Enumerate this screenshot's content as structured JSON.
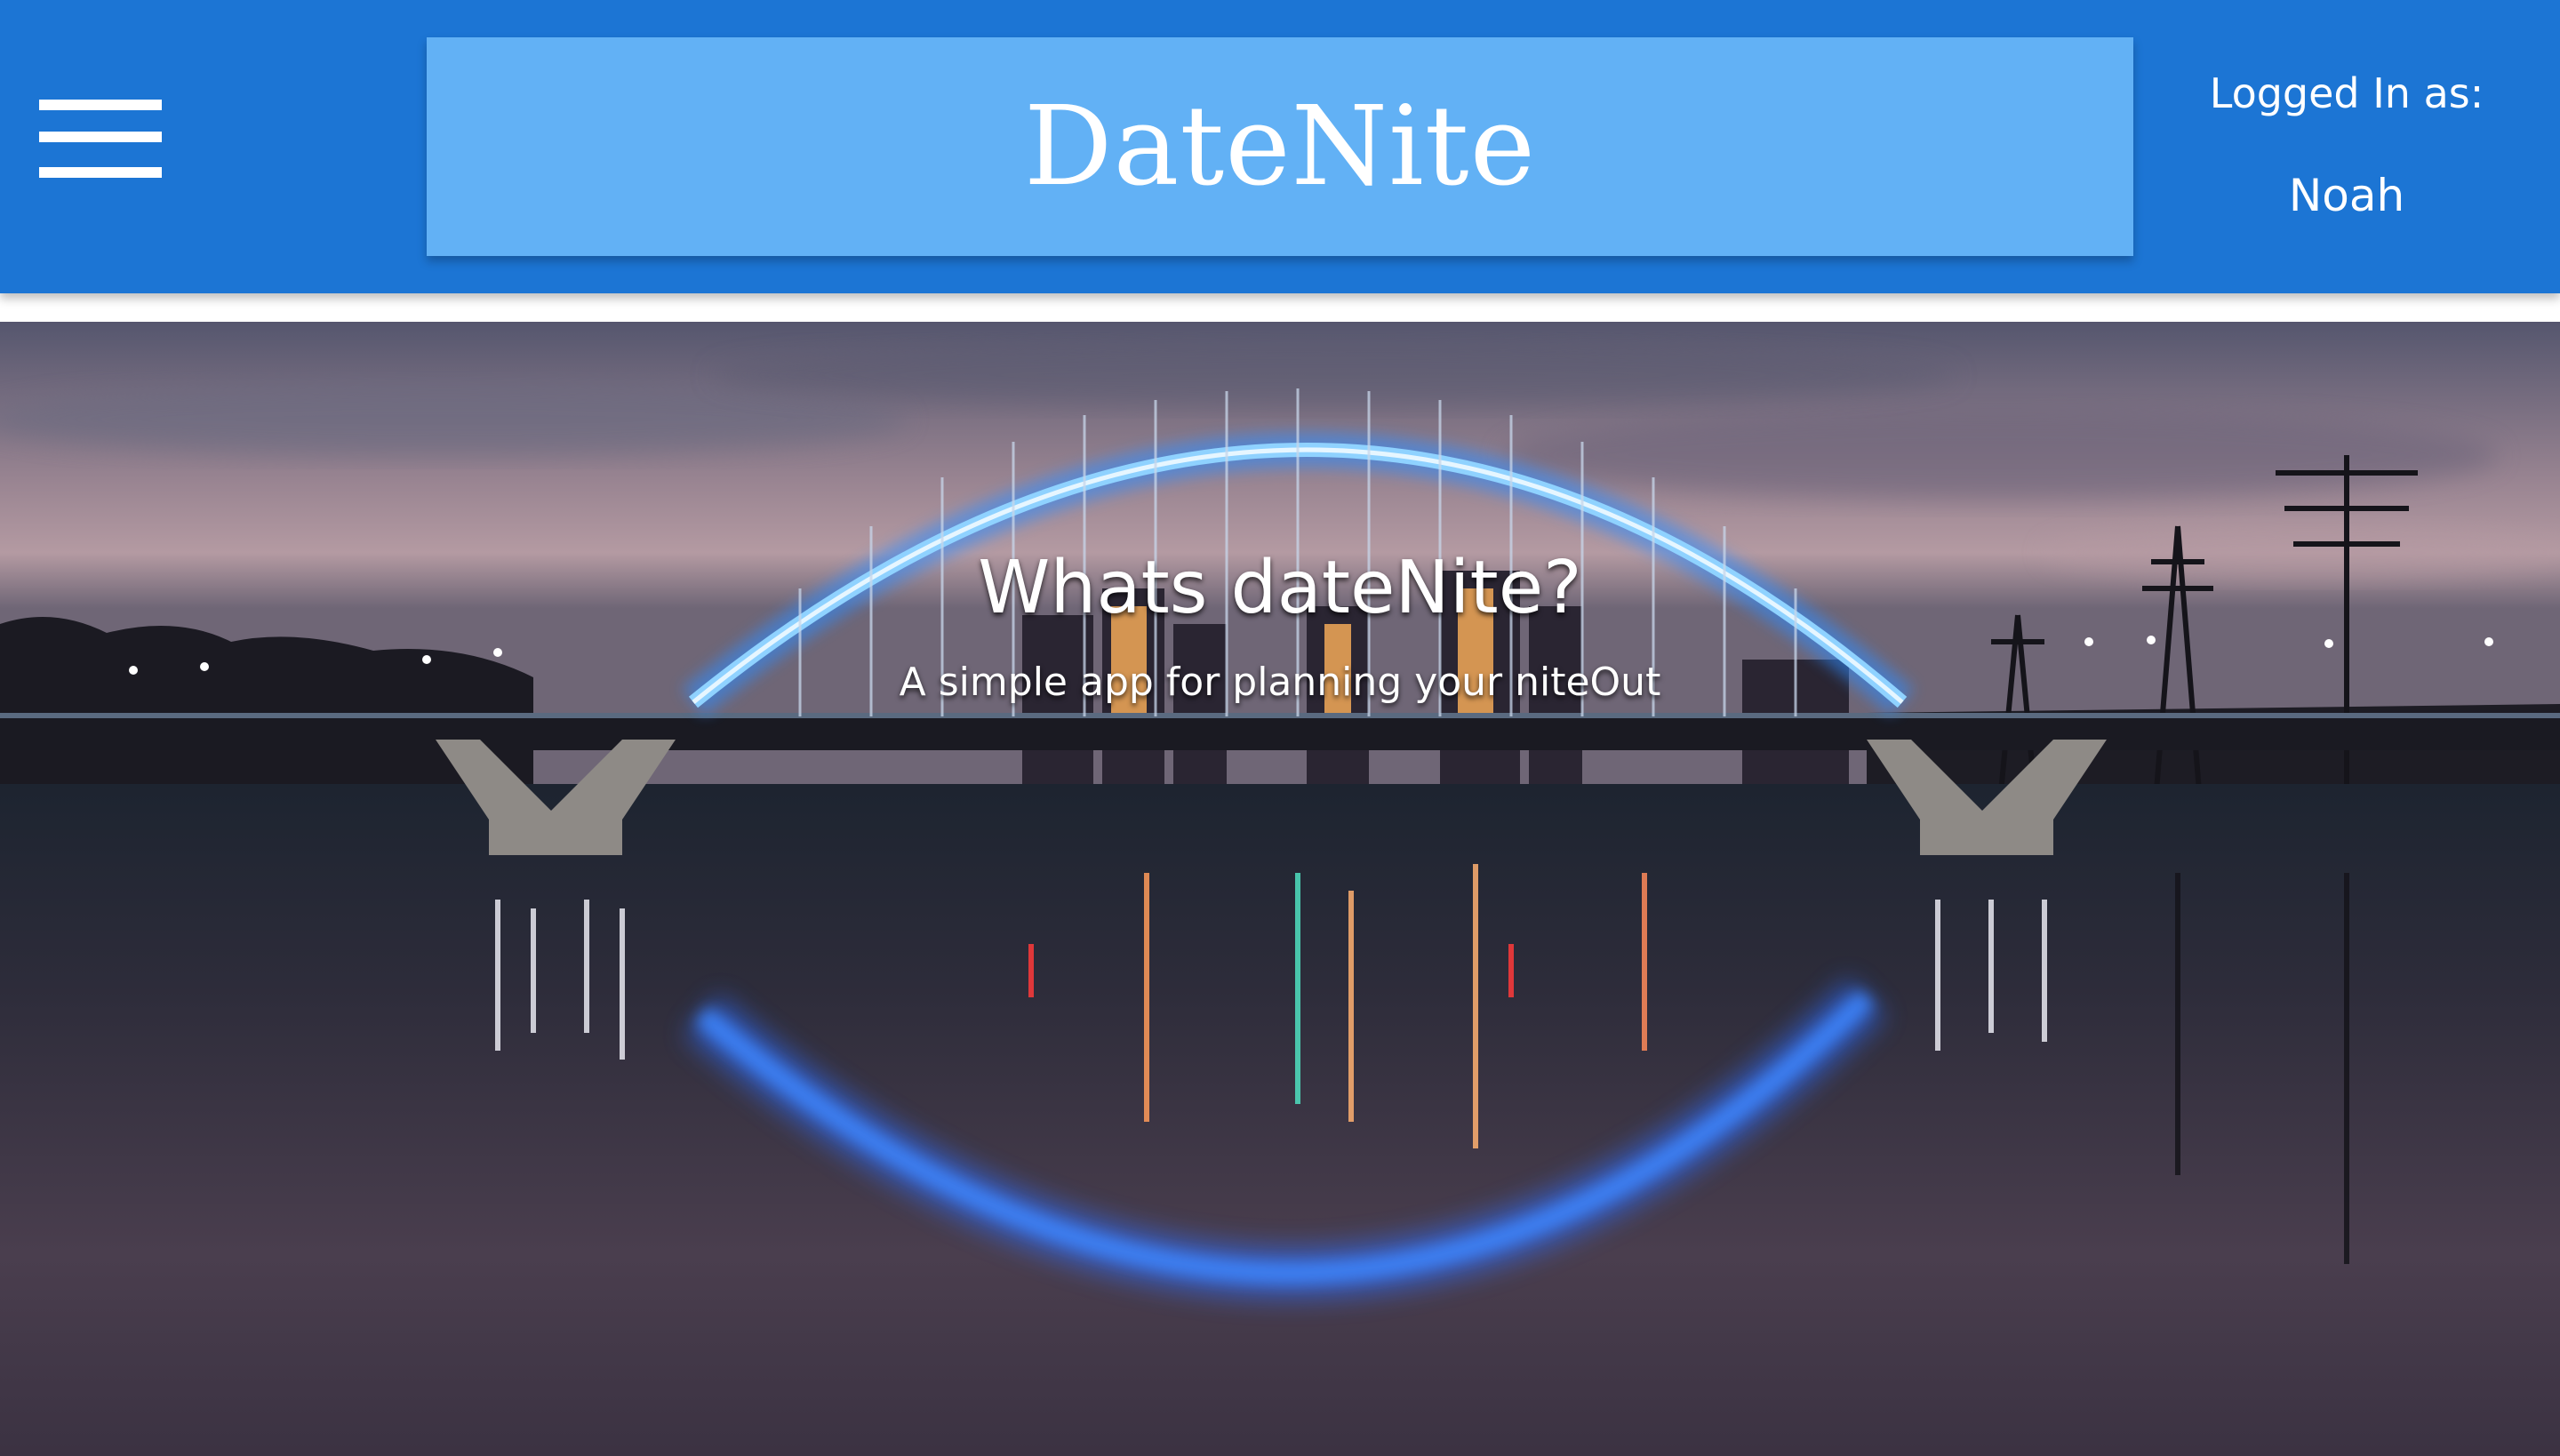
{
  "header": {
    "menu_icon": "hamburger-menu-icon",
    "brand": "DateNite",
    "login_label": "Logged In as:",
    "user_name": "Noah"
  },
  "hero": {
    "heading": "Whats dateNite?",
    "subheading": "A simple app for planning your niteOut"
  },
  "colors": {
    "header_bg": "#1c75d4",
    "brand_bg": "#62b1f5",
    "text": "#ffffff"
  }
}
